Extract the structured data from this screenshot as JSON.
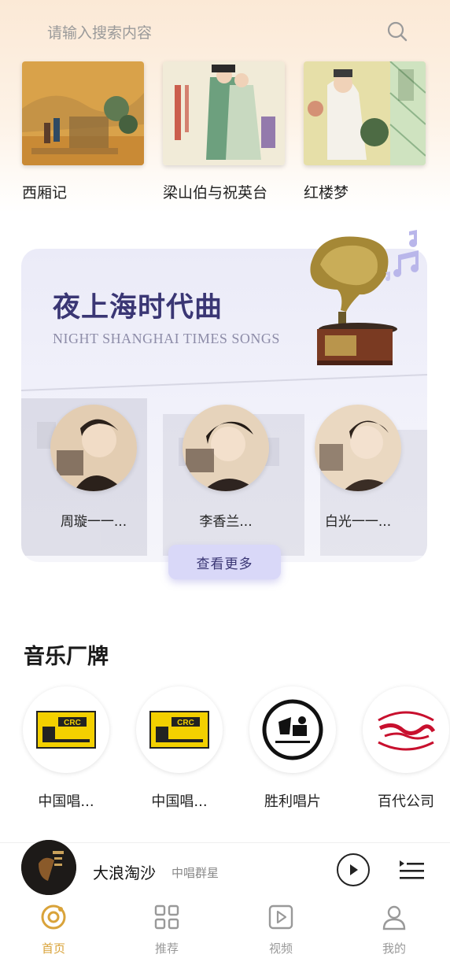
{
  "search": {
    "placeholder": "请输入搜索内容"
  },
  "albums": [
    {
      "title": "西厢记"
    },
    {
      "title": "梁山伯与祝英台"
    },
    {
      "title": "红楼梦"
    }
  ],
  "promo": {
    "title": "夜上海时代曲",
    "subtitle": "NIGHT SHANGHAI TIMES SONGS",
    "singers": [
      {
        "name": "周璇一一..."
      },
      {
        "name": "李香兰..."
      },
      {
        "name": "白光一一..."
      }
    ],
    "more_label": "查看更多"
  },
  "brands": {
    "section_title": "音乐厂牌",
    "items": [
      {
        "name": "中国唱..."
      },
      {
        "name": "中国唱..."
      },
      {
        "name": "胜利唱片"
      },
      {
        "name": "百代公司"
      }
    ]
  },
  "player": {
    "song": "大浪淘沙",
    "artist": "中唱群星"
  },
  "tabs": [
    {
      "label": "首页"
    },
    {
      "label": "推荐"
    },
    {
      "label": "视频"
    },
    {
      "label": "我的"
    }
  ],
  "colors": {
    "accent": "#d9a33a",
    "promo_title": "#3a3674",
    "more_button_bg": "#d9d8f8"
  }
}
